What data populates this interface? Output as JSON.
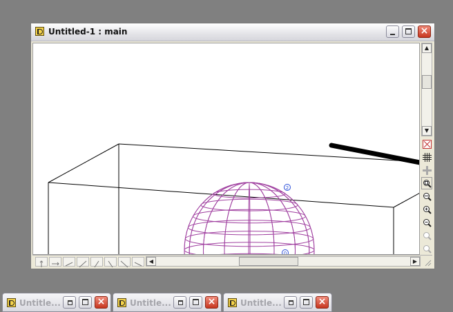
{
  "window": {
    "title": "Untitled-1 : main"
  },
  "viewport": {
    "sphere_color": "#a040a0",
    "marker_1": "2",
    "marker_2": "0"
  },
  "tools": [
    {
      "name": "delete-tool",
      "icon": "delete-icon"
    },
    {
      "name": "grid-tool",
      "icon": "grid-icon"
    },
    {
      "name": "add-tool",
      "icon": "plus-icon"
    },
    {
      "name": "zoom-region-tool",
      "icon": "zoom-region-icon"
    },
    {
      "name": "zoom-fit-tool",
      "icon": "zoom-fit-icon"
    },
    {
      "name": "zoom-in-tool",
      "icon": "zoom-in-icon"
    },
    {
      "name": "zoom-out-tool",
      "icon": "zoom-out-icon"
    },
    {
      "name": "zoom-previous-tool",
      "icon": "zoom-previous-icon"
    },
    {
      "name": "zoom-next-tool",
      "icon": "zoom-next-icon"
    }
  ],
  "taskbar": [
    {
      "title": "Untitle..."
    },
    {
      "title": "Untitle..."
    },
    {
      "title": "Untitle..."
    }
  ]
}
